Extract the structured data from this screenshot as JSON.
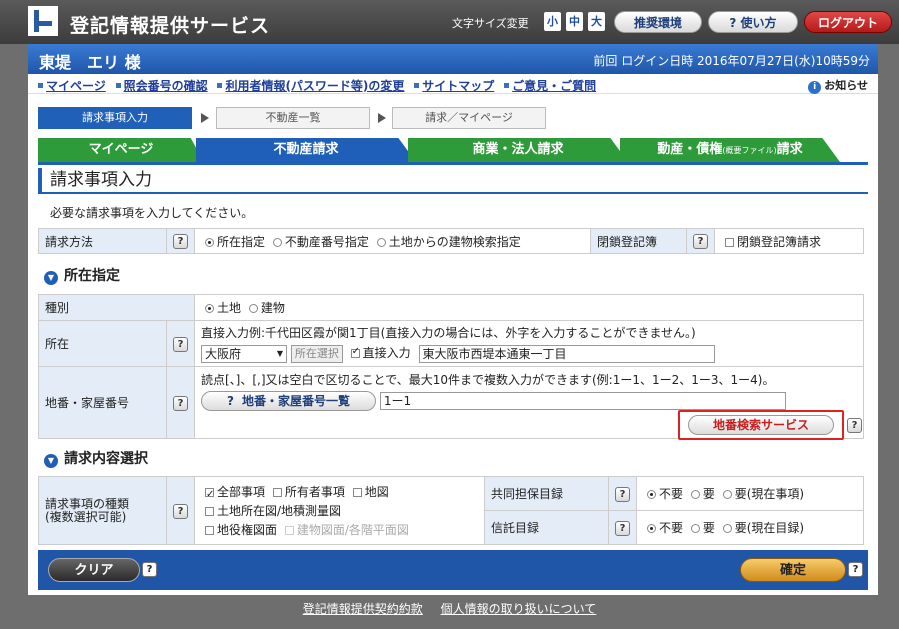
{
  "header": {
    "service_title": "登記情報提供サービス",
    "font_size_label": "文字サイズ変更",
    "font_sizes": [
      "小",
      "中",
      "大"
    ],
    "recommended_env": "推奨環境",
    "usage_help": "? 使い方",
    "logout": "ログアウト"
  },
  "user_bar": {
    "user_name": "東堤　エリ 様",
    "last_login": "前回 ログイン日時 2016年07月27日(水)10時59分"
  },
  "nav": {
    "links": [
      "マイページ",
      "照会番号の確認",
      "利用者情報(パスワード等)の変更",
      "サイトマップ",
      "ご意見・ご質問"
    ],
    "notice": "お知らせ"
  },
  "steps": [
    "請求事項入力",
    "不動産一覧",
    "請求／マイページ"
  ],
  "tabs": {
    "mypage": "マイページ",
    "realestate": "不動産請求",
    "corporate": "商業・法人請求",
    "movable_main": "動産・債権",
    "movable_small": "(概要ファイル)",
    "movable_tail": "請求"
  },
  "page_title": "請求事項入力",
  "instruction": "必要な請求事項を入力してください。",
  "request_method": {
    "label": "請求方法",
    "options": [
      "所在指定",
      "不動産番号指定",
      "土地からの建物検索指定"
    ],
    "closed_label": "閉鎖登記簿",
    "closed_option": "閉鎖登記簿請求"
  },
  "location_section": {
    "title": "所在指定",
    "type_label": "種別",
    "type_options": [
      "土地",
      "建物"
    ],
    "location_label": "所在",
    "location_hint": "直接入力例:千代田区霞が関1丁目(直接入力の場合には、外字を入力することができません。)",
    "prefecture": "大阪府",
    "select_button": "所在選択",
    "direct_input_label": "直接入力",
    "direct_input_value": "東大阪市西堤本通東一丁目",
    "lot_label": "地番・家屋番号",
    "lot_hint": "読点[、]、[,]又は空白で区切ることで、最大10件まで複数入力ができます(例:1ー1、1ー2、1ー3、1ー4)。",
    "lot_list_button": "地番・家屋番号一覧",
    "lot_value": "1ー1",
    "lot_search_button": "地番検索サービス"
  },
  "content_section": {
    "title": "請求内容選択",
    "kind_label_1": "請求事項の種類",
    "kind_label_2": "(複数選択可能)",
    "kinds_row1": [
      "全部事項",
      "所有者事項",
      "地図"
    ],
    "kinds_row2": [
      "土地所在図/地積測量図"
    ],
    "kinds_row3": [
      "地役権図面",
      "建物図面/各階平面図"
    ],
    "joint_label": "共同担保目録",
    "trust_label": "信託目録",
    "joint_options": [
      "不要",
      "要",
      "要(現在事項)"
    ],
    "trust_options": [
      "不要",
      "要",
      "要(現在目録)"
    ]
  },
  "actions": {
    "clear": "クリア",
    "confirm": "確定"
  },
  "footer": {
    "links": [
      "登記情報提供契約約款",
      "個人情報の取り扱いについて"
    ]
  }
}
